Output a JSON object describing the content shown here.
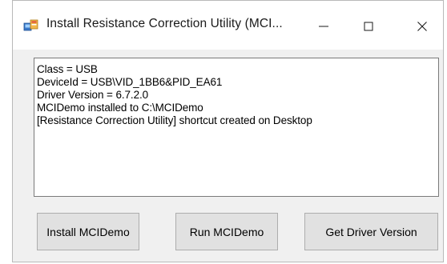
{
  "window": {
    "title": "Install Resistance Correction Utility (MCI...",
    "controls": {
      "minimize_icon": "minimize-icon",
      "maximize_icon": "maximize-icon",
      "close_icon": "close-icon"
    }
  },
  "output": {
    "lines": [
      "Class = USB",
      "DeviceId = USB\\VID_1BB6&PID_EA61",
      "Driver Version = 6.7.2.0",
      "MCIDemo installed to C:\\MCIDemo",
      "[Resistance Correction Utility] shortcut created on Desktop"
    ]
  },
  "buttons": {
    "install": "Install MCIDemo",
    "run": "Run MCIDemo",
    "get_version": "Get Driver Version"
  }
}
